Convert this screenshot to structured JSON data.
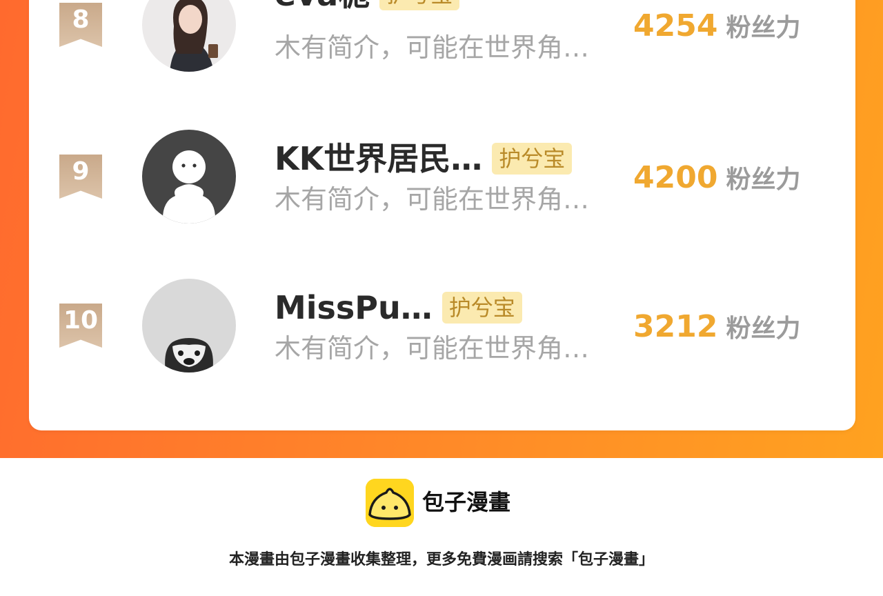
{
  "rankings": [
    {
      "rank": "8",
      "name": "eva栀",
      "badge": "护兮宝",
      "intro": "木有简介，可能在世界角…",
      "score": "4254",
      "score_label": "粉丝力"
    },
    {
      "rank": "9",
      "name": "KK世界居民…",
      "badge": "护兮宝",
      "intro": "木有简介，可能在世界角…",
      "score": "4200",
      "score_label": "粉丝力"
    },
    {
      "rank": "10",
      "name": "MissPu…",
      "badge": "护兮宝",
      "intro": "木有简介，可能在世界角…",
      "score": "3212",
      "score_label": "粉丝力"
    }
  ],
  "footer": {
    "brand": "包子漫畫",
    "note": "本漫畫由包子漫畫收集整理，更多免費漫画請搜索「包子漫畫」"
  },
  "colors": {
    "accent_gradient_start": "#ff6a2e",
    "accent_gradient_end": "#ffa220",
    "score_color": "#f0a830",
    "badge_bg": "#fbeab0",
    "logo_yellow": "#ffd61f"
  },
  "icons": [
    "rank-ribbon-icon",
    "bun-logo-icon"
  ]
}
